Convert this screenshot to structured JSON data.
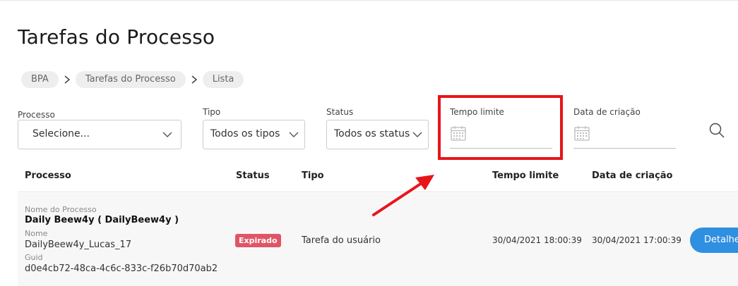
{
  "page": {
    "title": "Tarefas do Processo"
  },
  "breadcrumb": [
    "BPA",
    "Tarefas do Processo",
    "Lista"
  ],
  "filters": {
    "processo": {
      "label": "Processo",
      "value": "Selecione..."
    },
    "tipo": {
      "label": "Tipo",
      "value": "Todos os tipos"
    },
    "status": {
      "label": "Status",
      "value": "Todos os status"
    },
    "tempo_limite": {
      "label": "Tempo limite"
    },
    "data_criacao": {
      "label": "Data de criação"
    }
  },
  "table": {
    "headers": {
      "processo": "Processo",
      "status": "Status",
      "tipo": "Tipo",
      "tempo_limite": "Tempo limite",
      "data_criacao": "Data de criação"
    },
    "rows": [
      {
        "nome_processo_label": "Nome do Processo",
        "nome_processo": "Daily Beew4y ( DailyBeew4y )",
        "nome_label": "Nome",
        "nome": "DailyBeew4y_Lucas_17",
        "guid_label": "Guid",
        "guid": "d0e4cb72-48ca-4c6c-833c-f26b70d70ab2",
        "status": "Expirado",
        "tipo": "Tarefa do usuário",
        "tempo_limite": "30/04/2021 18:00:39",
        "data_criacao": "30/04/2021 17:00:39",
        "action": "Detalhes"
      }
    ]
  },
  "colors": {
    "highlight": "#e8141b",
    "badge_expired": "#e05566",
    "primary_button": "#2f8fe0"
  },
  "icons": {
    "calendar": "calendar-icon",
    "search": "search-icon",
    "chevron": "chevron-down-icon",
    "breadcrumb_separator": "chevron-right-icon"
  }
}
